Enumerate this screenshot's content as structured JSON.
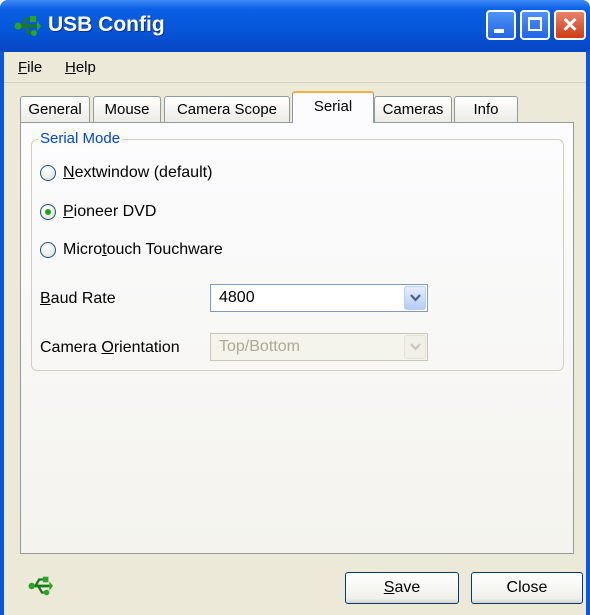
{
  "window": {
    "title": "USB Config",
    "icon": "usb-icon"
  },
  "titlebar_buttons": {
    "minimize": "minimize-icon",
    "maximize": "maximize-icon",
    "close": "×"
  },
  "menu": {
    "file": {
      "accel": "F",
      "rest": "ile"
    },
    "help": {
      "accel": "H",
      "rest": "elp"
    }
  },
  "tabs": [
    {
      "label": "General"
    },
    {
      "label": "Mouse"
    },
    {
      "label": "Camera Scope"
    },
    {
      "label": "Serial",
      "active": true
    },
    {
      "label": "Cameras"
    },
    {
      "label": "Info"
    }
  ],
  "serial": {
    "group_title": "Serial Mode",
    "options": [
      {
        "pre": "",
        "accel": "N",
        "rest": "extwindow (default)",
        "checked": false
      },
      {
        "pre": "",
        "accel": "P",
        "rest": "ioneer DVD",
        "checked": true
      },
      {
        "pre": "Micro",
        "accel": "t",
        "rest": "ouch Touchware",
        "checked": false
      }
    ],
    "baud": {
      "accel": "B",
      "rest": "aud Rate",
      "value": "4800"
    },
    "orientation": {
      "pre": "Camera ",
      "accel": "O",
      "rest": "rientation",
      "value": "Top/Bottom",
      "disabled": true
    }
  },
  "buttons": {
    "save": {
      "accel": "S",
      "rest": "ave"
    },
    "close": "Close"
  },
  "colors": {
    "titlebar": "#0a57d8",
    "client": "#ece9d8",
    "group_title": "#0046d5",
    "radio_checked": "#21a121"
  }
}
